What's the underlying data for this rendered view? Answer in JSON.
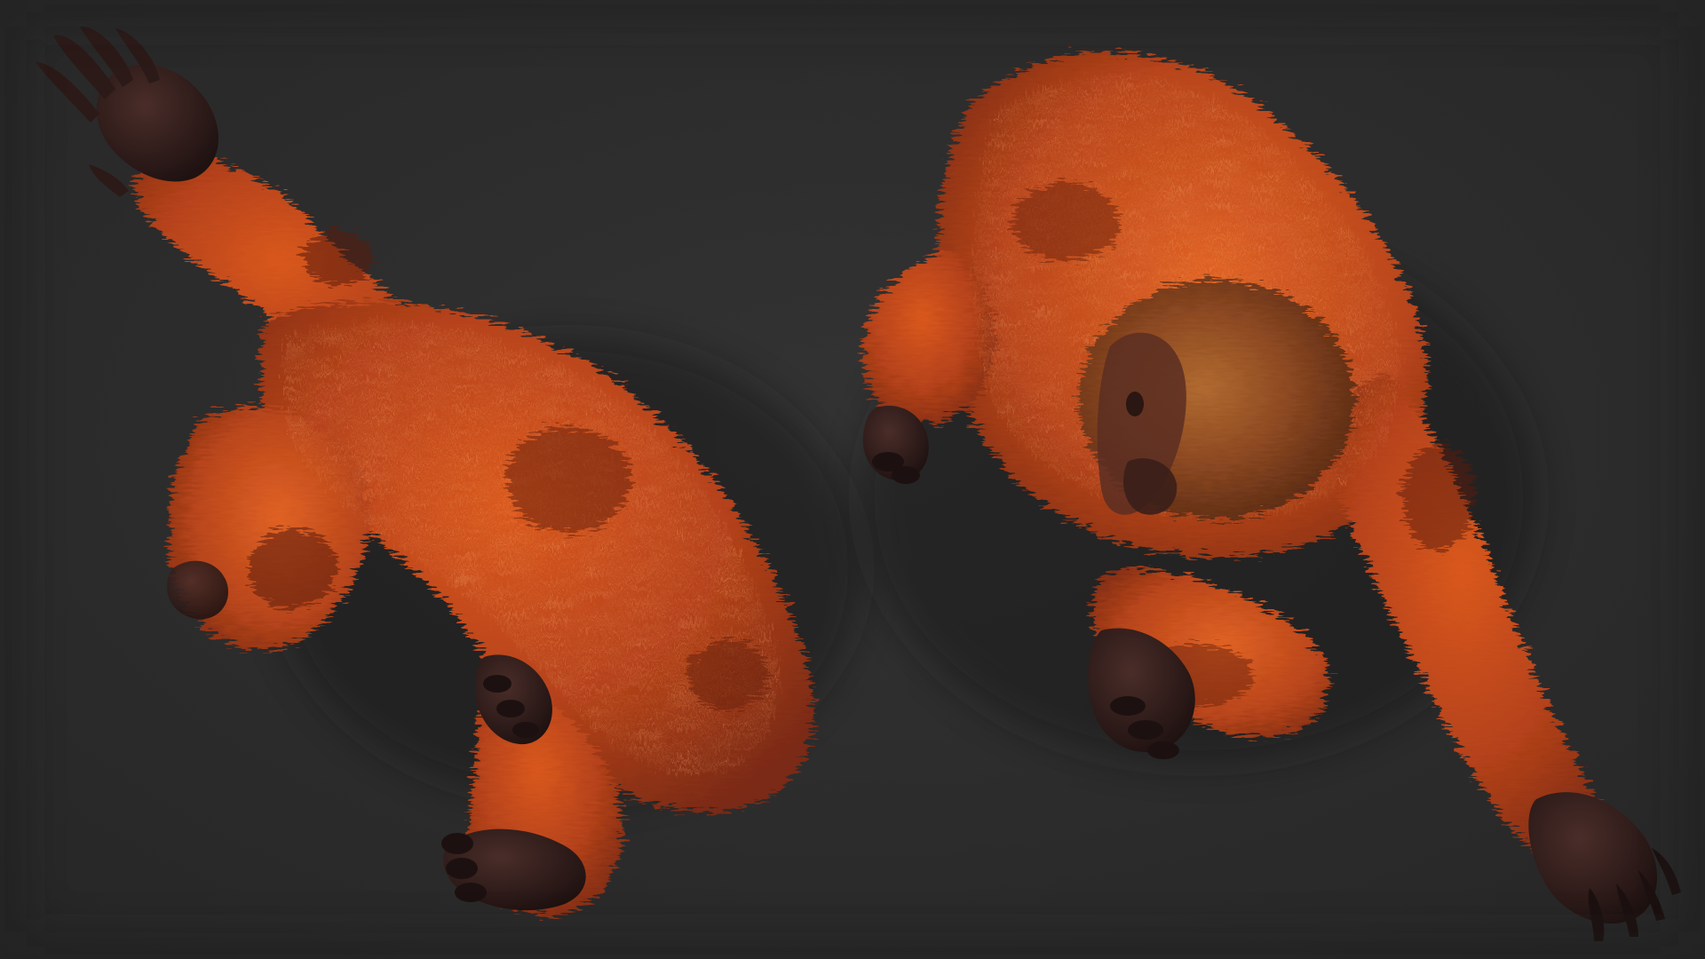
{
  "scene": {
    "subjects": [
      "orangutan-back-view",
      "orangutan-top-view"
    ],
    "colors": {
      "background": "#2b2b2b",
      "fur_dark": "#6e2410",
      "fur_mid": "#a83a17",
      "fur_light": "#d4561f",
      "fur_highlight": "#e9743a",
      "skin": "#3a2320",
      "skin_dark": "#231413",
      "face_fur": "#9a5a2a"
    }
  }
}
